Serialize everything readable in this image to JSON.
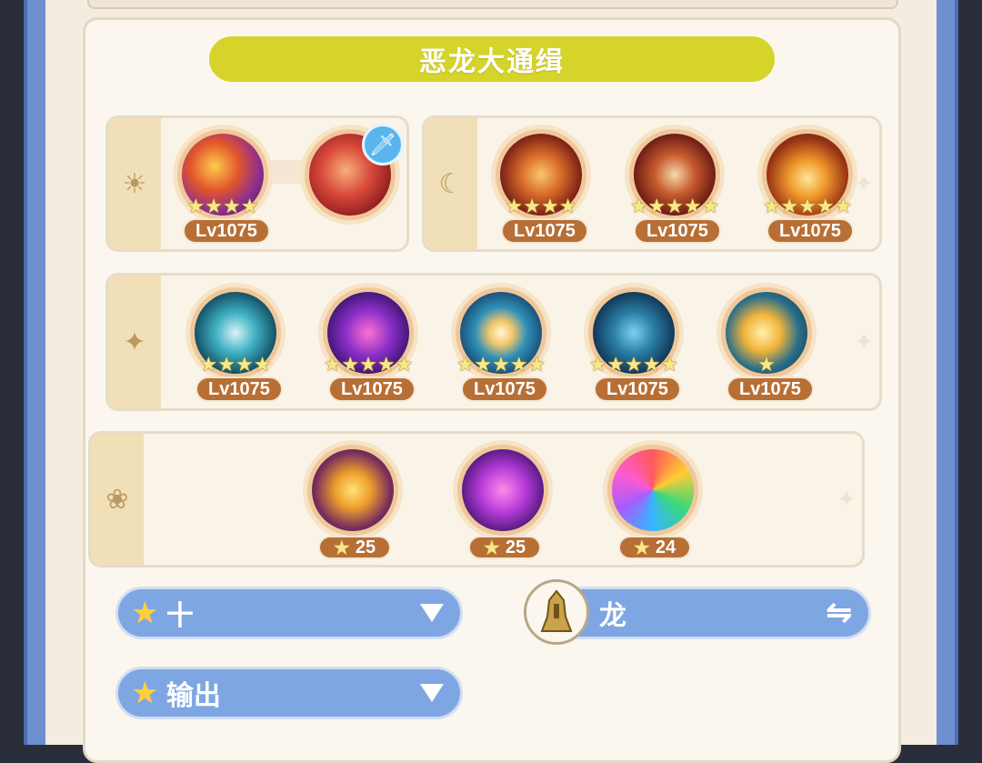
{
  "title": "恶龙大通缉",
  "row1": {
    "group1": {
      "icon": "sun-icon",
      "skills": [
        {
          "name": "fire-element-skill",
          "level": "Lv1075",
          "stars": "★★★★"
        },
        {
          "name": "red-slash-skill",
          "level": "",
          "stars": "",
          "badge": "water-sword-icon"
        }
      ]
    },
    "group2": {
      "icon": "moon-icon",
      "skills": [
        {
          "name": "dragon-rune-skill",
          "level": "Lv1075",
          "stars": "★★★★"
        },
        {
          "name": "lightning-claw-skill",
          "level": "Lv1075",
          "stars": "★★★★★"
        },
        {
          "name": "flaming-sword-skill",
          "level": "Lv1075",
          "stars": "★★★★★"
        }
      ]
    }
  },
  "row2": {
    "icon": "sparkle-icon",
    "skills": [
      {
        "name": "card-skill",
        "level": "Lv1075",
        "stars": "★★★★"
      },
      {
        "name": "neon-toast-skill",
        "level": "Lv1075",
        "stars": "★★★★★"
      },
      {
        "name": "heart-skill",
        "level": "Lv1075",
        "stars": "★★★★★"
      },
      {
        "name": "shadow-hero-skill",
        "level": "Lv1075",
        "stars": "★★★★★"
      },
      {
        "name": "golden-wave-skill",
        "level": "Lv1075",
        "stars": "★"
      }
    ]
  },
  "row3": {
    "icon": "flower-icon",
    "items": [
      {
        "name": "lotus-emblem",
        "count": "25"
      },
      {
        "name": "neon-champagne",
        "count": "25"
      },
      {
        "name": "rainbow-chest",
        "count": "24"
      }
    ]
  },
  "controls": {
    "dropdown1": "十",
    "dropdown2": "输出",
    "boss_select": "龙"
  },
  "colors": {
    "title_bar": "#d6d42a",
    "level_badge": "#b76f36",
    "dropdown": "#7ea6e2",
    "frame": "#6e8fd0"
  }
}
